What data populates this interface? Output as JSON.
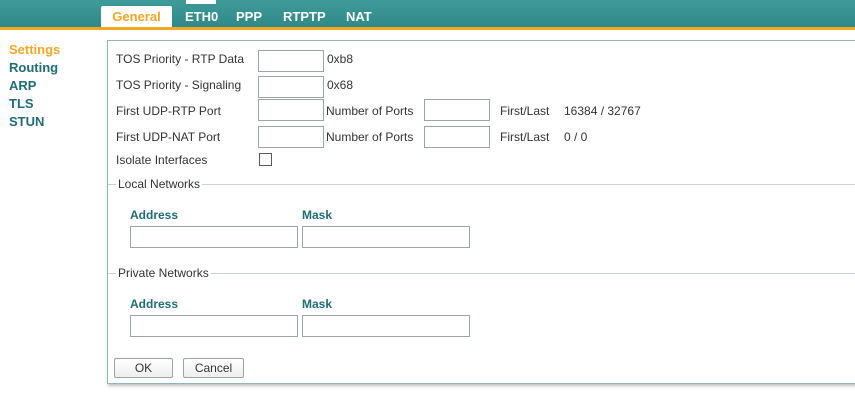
{
  "tabs": [
    {
      "label": "General"
    },
    {
      "label": "ETH0"
    },
    {
      "label": "PPP"
    },
    {
      "label": "RTPTP"
    },
    {
      "label": "NAT"
    }
  ],
  "sidebar": {
    "items": [
      {
        "label": "Settings"
      },
      {
        "label": "Routing"
      },
      {
        "label": "ARP"
      },
      {
        "label": "TLS"
      },
      {
        "label": "STUN"
      }
    ]
  },
  "form": {
    "tos_rtp": {
      "label": "TOS Priority - RTP Data",
      "value": "",
      "hint": "0xb8"
    },
    "tos_sig": {
      "label": "TOS Priority - Signaling",
      "value": "",
      "hint": "0x68"
    },
    "udp_rtp": {
      "label": "First UDP-RTP Port",
      "value": "",
      "ports_label": "Number of Ports",
      "ports_value": "",
      "firstlast_label": "First/Last",
      "firstlast_value": "16384 / 32767"
    },
    "udp_nat": {
      "label": "First UDP-NAT Port",
      "value": "",
      "ports_label": "Number of Ports",
      "ports_value": "",
      "firstlast_label": "First/Last",
      "firstlast_value": "0 / 0"
    },
    "isolate": {
      "label": "Isolate Interfaces",
      "checked": false
    }
  },
  "local_networks": {
    "legend": "Local Networks",
    "address_header": "Address",
    "mask_header": "Mask",
    "address_value": "",
    "mask_value": ""
  },
  "private_networks": {
    "legend": "Private Networks",
    "address_header": "Address",
    "mask_header": "Mask",
    "address_value": "",
    "mask_value": ""
  },
  "buttons": {
    "ok": "OK",
    "cancel": "Cancel"
  },
  "colors": {
    "accent": "#f5a623",
    "header_bg": "#2d8787",
    "nav_text": "#1f6d78"
  }
}
